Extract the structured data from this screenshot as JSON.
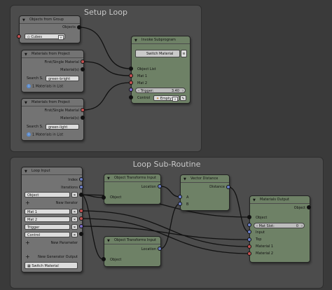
{
  "frames": {
    "setup_title": "Setup Loop",
    "loop_title": "Loop Sub-Routine"
  },
  "nodes": {
    "objects_from_group": {
      "title": "Objects from Group",
      "out_objects": "Objects",
      "group_value": "Cubes"
    },
    "materials_project_1": {
      "title": "Materials from Project",
      "out_first": "First/Single Material",
      "out_materials": "Material(s)",
      "search_label": "Search S.",
      "search_value": "green-bright",
      "status": "1 Materials in List"
    },
    "materials_project_2": {
      "title": "Materials from Project",
      "out_first": "First/Single Material",
      "out_materials": "Material(s)",
      "search_label": "Search S.",
      "search_value": "green-light",
      "status": "1 Materials in List"
    },
    "invoke_subprogram": {
      "title": "Invoke Subprogram",
      "program": "Switch Material",
      "in_object_list": "Object List",
      "in_mat1": "Mat 1",
      "in_mat2": "Mat 2",
      "trigger_label": "Trigger:",
      "trigger_value": "3.40",
      "control_label": "Control",
      "control_value": "Empty"
    },
    "loop_input": {
      "title": "Loop Input",
      "out_index": "Index",
      "out_iterations": "Iterations",
      "param_object": "Object",
      "new_iterator": "New Iterator",
      "param_mat1": "Mat 1",
      "param_mat2": "Mat 2",
      "param_trigger": "Trigger",
      "param_control": "Control",
      "new_parameter": "New Parameter",
      "new_generator_output": "New Generator Output",
      "program_name": "Switch Material"
    },
    "transforms_input_1": {
      "title": "Object Transforms Input",
      "out_location": "Location",
      "in_object": "Object"
    },
    "transforms_input_2": {
      "title": "Object Transforms Input",
      "out_location": "Location",
      "in_object": "Object"
    },
    "vector_distance": {
      "title": "Vector Distance",
      "out_distance": "Distance",
      "in_a": "A",
      "in_b": "B"
    },
    "materials_output": {
      "title": "Materials Output",
      "out_object": "Object",
      "in_object": "Object",
      "mat_slot_label": "Mat Slot:",
      "mat_slot_value": "0",
      "in_input": "Input",
      "in_top": "Top",
      "in_material1": "Material 1",
      "in_material2": "Material 2"
    }
  },
  "colors": {
    "background": "#3a3a3a",
    "frame": "#4c4c4c",
    "node": "#737373",
    "node_green": "#6e8166",
    "socket_object": "#111111",
    "socket_material": "#c45050",
    "socket_vector": "#6b7ec8",
    "link": "#111111"
  }
}
